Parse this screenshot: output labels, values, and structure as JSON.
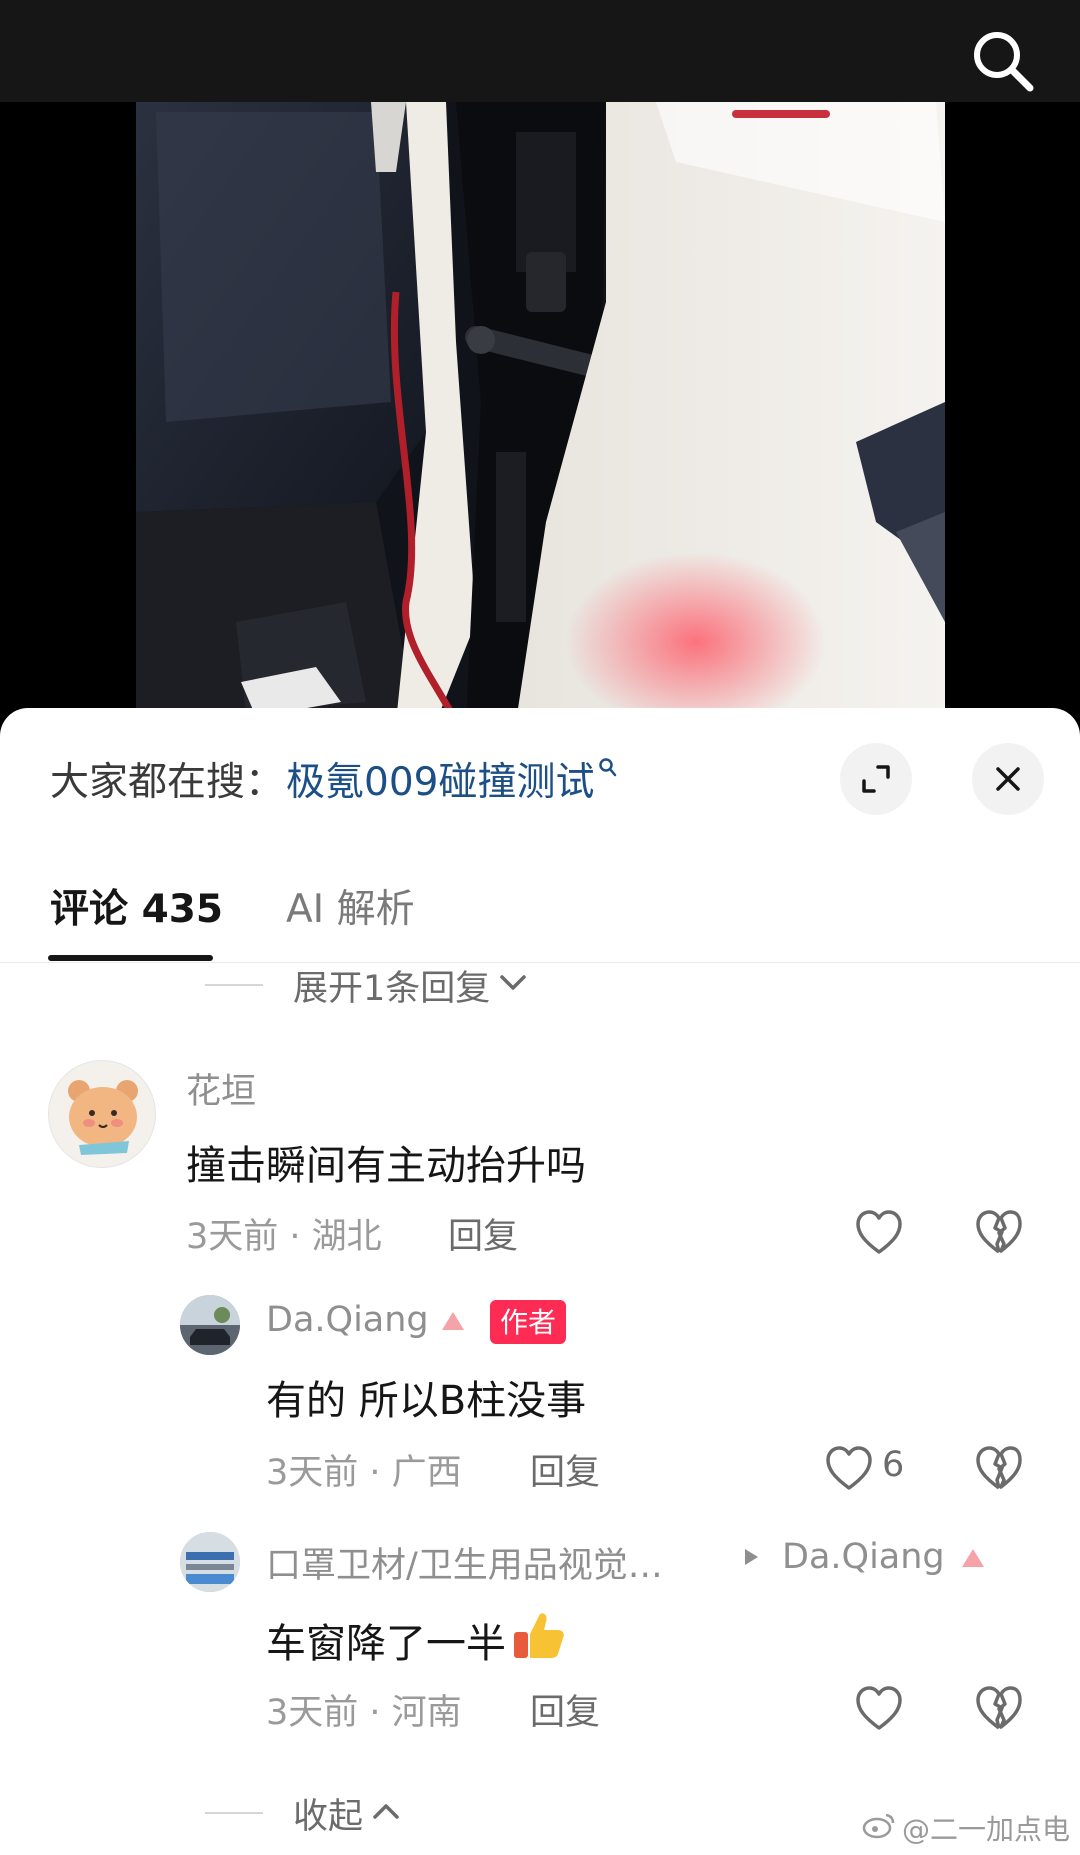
{
  "search": {
    "prefix": "大家都在搜：",
    "term": "极氪009碰撞测试"
  },
  "tabs": [
    {
      "label": "评论 435"
    },
    {
      "label": "AI 解析"
    }
  ],
  "expand_replies": "展开1条回复",
  "comments": [
    {
      "username": "花垣",
      "text": "撞击瞬间有主动抬升吗",
      "meta": "3天前 · 湖北",
      "reply": "回复"
    },
    {
      "username": "Da.Qiang",
      "badge": "作者",
      "text": "有的 所以B柱没事",
      "meta": "3天前 · 广西",
      "reply": "回复",
      "likes": "6"
    },
    {
      "username": "口罩卫材/卫生用品视觉…",
      "reply_to": "Da.Qiang",
      "text": "车窗降了一半",
      "meta": "3天前 · 河南",
      "reply": "回复"
    }
  ],
  "collapse": "收起",
  "watermark": "@二一加点电"
}
